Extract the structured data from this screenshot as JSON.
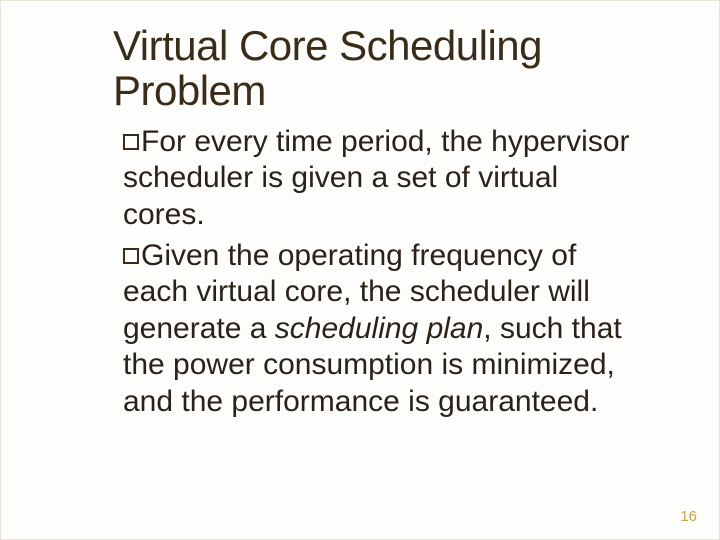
{
  "title": "Virtual Core Scheduling Problem",
  "bullets": [
    {
      "lead": "For",
      "rest": " every time period, the hypervisor scheduler is given a set of virtual cores."
    },
    {
      "lead": "Given",
      "rest_before": " the operating frequency of each virtual core, the scheduler will generate a ",
      "emph": "scheduling plan",
      "rest_after": ", such that the power consumption is minimized, and the performance is guaranteed."
    }
  ],
  "page_number": "16"
}
